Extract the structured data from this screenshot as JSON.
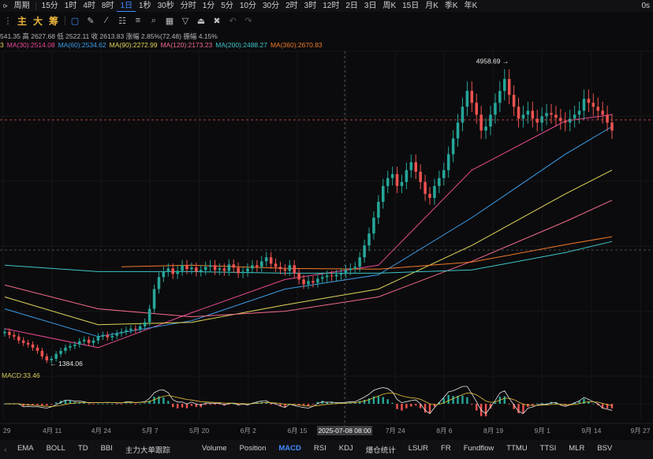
{
  "top": {
    "symbol_icon": "chart-icon",
    "period_label": "周期",
    "timeframes": [
      "15分",
      "1时",
      "4时",
      "8时",
      "1日",
      "1秒",
      "30秒",
      "分时",
      "1分",
      "5分",
      "10分",
      "30分",
      "2时",
      "3时",
      "12时",
      "2日",
      "3日",
      "周K",
      "15日",
      "月K",
      "季K",
      "年K"
    ],
    "active_timeframe": "1日",
    "right_text": "0s"
  },
  "toolbar": {
    "tags": [
      {
        "text": "主",
        "color": "#e8b23c"
      },
      {
        "text": "大",
        "color": "#e8b23c"
      },
      {
        "text": "筹",
        "color": "#e8b23c"
      }
    ]
  },
  "info": {
    "ohlc": "541.35  高 2627.68  低 2522.11  收 2613.83  涨幅 2.85%(72.48)  振幅 4.15%",
    "ma": [
      {
        "text": "3",
        "color": "#f0d44a"
      },
      {
        "text": "MA(30):2514.08",
        "color": "#e84a93"
      },
      {
        "text": "MA(60):2534.62",
        "color": "#3d9ee8"
      },
      {
        "text": "MA(90):2272.99",
        "color": "#e2d65a"
      },
      {
        "text": "MA(120):2173.23",
        "color": "#f06a8a"
      },
      {
        "text": "MA(200):2488.27",
        "color": "#3fc6c9"
      },
      {
        "text": "MA(360):2670.83",
        "color": "#f07a2a"
      }
    ]
  },
  "chart_data": {
    "type": "candlestick",
    "x_tick_labels": [
      "29",
      "4月 11",
      "4月 24",
      "5月 7",
      "5月 20",
      "6月 2",
      "6月 15",
      "6月 2",
      "7月 24",
      "8月 6",
      "8月 19",
      "9月 1",
      "9月 14",
      "9月 27"
    ],
    "crosshair_label": "2025-07-08 08:00",
    "high_annotation": "4958.69",
    "low_annotation": "1384.06",
    "macd_label": "MACD:33.46",
    "up_color": "#26a69a",
    "down_color": "#ef5350",
    "closes": [
      1760,
      1720,
      1700,
      1650,
      1620,
      1600,
      1560,
      1520,
      1450,
      1400,
      1420,
      1480,
      1520,
      1560,
      1580,
      1600,
      1640,
      1660,
      1620,
      1650,
      1700,
      1720,
      1690,
      1710,
      1740,
      1760,
      1780,
      1800,
      1790,
      1830,
      1880,
      2050,
      2300,
      2450,
      2520,
      2560,
      2490,
      2530,
      2600,
      2550,
      2570,
      2520,
      2540,
      2580,
      2600,
      2540,
      2560,
      2530,
      2610,
      2570,
      2500,
      2520,
      2560,
      2600,
      2580,
      2650,
      2700,
      2620,
      2580,
      2550,
      2530,
      2600,
      2500,
      2420,
      2360,
      2400,
      2380,
      2430,
      2450,
      2470,
      2460,
      2480,
      2500,
      2540,
      2560,
      2580,
      2700,
      2850,
      3000,
      3200,
      3400,
      3600,
      3700,
      3750,
      3600,
      3650,
      3800,
      3900,
      3780,
      3650,
      3500,
      3450,
      3600,
      3700,
      3800,
      4000,
      4200,
      4400,
      4600,
      4800,
      4650,
      4500,
      4300,
      4350,
      4500,
      4650,
      4800,
      4950,
      4750,
      4600,
      4450,
      4500,
      4550,
      4450,
      4400,
      4480,
      4520,
      4500,
      4460,
      4420,
      4400,
      4450,
      4500,
      4550,
      4700,
      4650,
      4600,
      4550,
      4500,
      4400,
      4300
    ],
    "ma_series": [
      {
        "name": "MA(30)",
        "color": "#e84a93",
        "points": [
          [
            0,
            1800
          ],
          [
            20,
            1560
          ],
          [
            40,
            2000
          ],
          [
            60,
            2420
          ],
          [
            80,
            2600
          ],
          [
            100,
            3800
          ],
          [
            120,
            4420
          ],
          [
            130,
            4500
          ]
        ]
      },
      {
        "name": "MA(60)",
        "color": "#3d9ee8",
        "points": [
          [
            0,
            2050
          ],
          [
            20,
            1700
          ],
          [
            40,
            1900
          ],
          [
            60,
            2300
          ],
          [
            80,
            2480
          ],
          [
            100,
            3200
          ],
          [
            120,
            4000
          ],
          [
            130,
            4350
          ]
        ]
      },
      {
        "name": "MA(90)",
        "color": "#e2d65a",
        "points": [
          [
            0,
            2200
          ],
          [
            20,
            1850
          ],
          [
            40,
            1880
          ],
          [
            60,
            2100
          ],
          [
            80,
            2300
          ],
          [
            100,
            2850
          ],
          [
            120,
            3500
          ],
          [
            130,
            3800
          ]
        ]
      },
      {
        "name": "MA(120)",
        "color": "#f06a8a",
        "points": [
          [
            0,
            2350
          ],
          [
            20,
            2050
          ],
          [
            40,
            1950
          ],
          [
            60,
            2020
          ],
          [
            80,
            2200
          ],
          [
            100,
            2650
          ],
          [
            120,
            3150
          ],
          [
            130,
            3420
          ]
        ]
      },
      {
        "name": "MA(200)",
        "color": "#3fc6c9",
        "points": [
          [
            0,
            2600
          ],
          [
            20,
            2520
          ],
          [
            40,
            2520
          ],
          [
            60,
            2500
          ],
          [
            80,
            2500
          ],
          [
            100,
            2540
          ],
          [
            120,
            2760
          ],
          [
            130,
            2900
          ]
        ]
      },
      {
        "name": "MA(360)",
        "color": "#f07a2a",
        "points": [
          [
            25,
            2580
          ],
          [
            40,
            2600
          ],
          [
            60,
            2560
          ],
          [
            80,
            2550
          ],
          [
            100,
            2640
          ],
          [
            120,
            2860
          ],
          [
            130,
            2960
          ]
        ]
      }
    ],
    "ylim": [
      1200,
      5300
    ]
  },
  "bottom": {
    "indicators": [
      "EMA",
      "BOLL",
      "TD",
      "BBI",
      "主力大单跟踪"
    ],
    "subs": [
      "Volume",
      "Position",
      "MACD",
      "RSI",
      "KDJ",
      "爆仓统计",
      "LSUR",
      "FR",
      "Fundflow",
      "TTMU",
      "TTSI",
      "MLR",
      "BSV"
    ],
    "active_sub": "MACD"
  }
}
